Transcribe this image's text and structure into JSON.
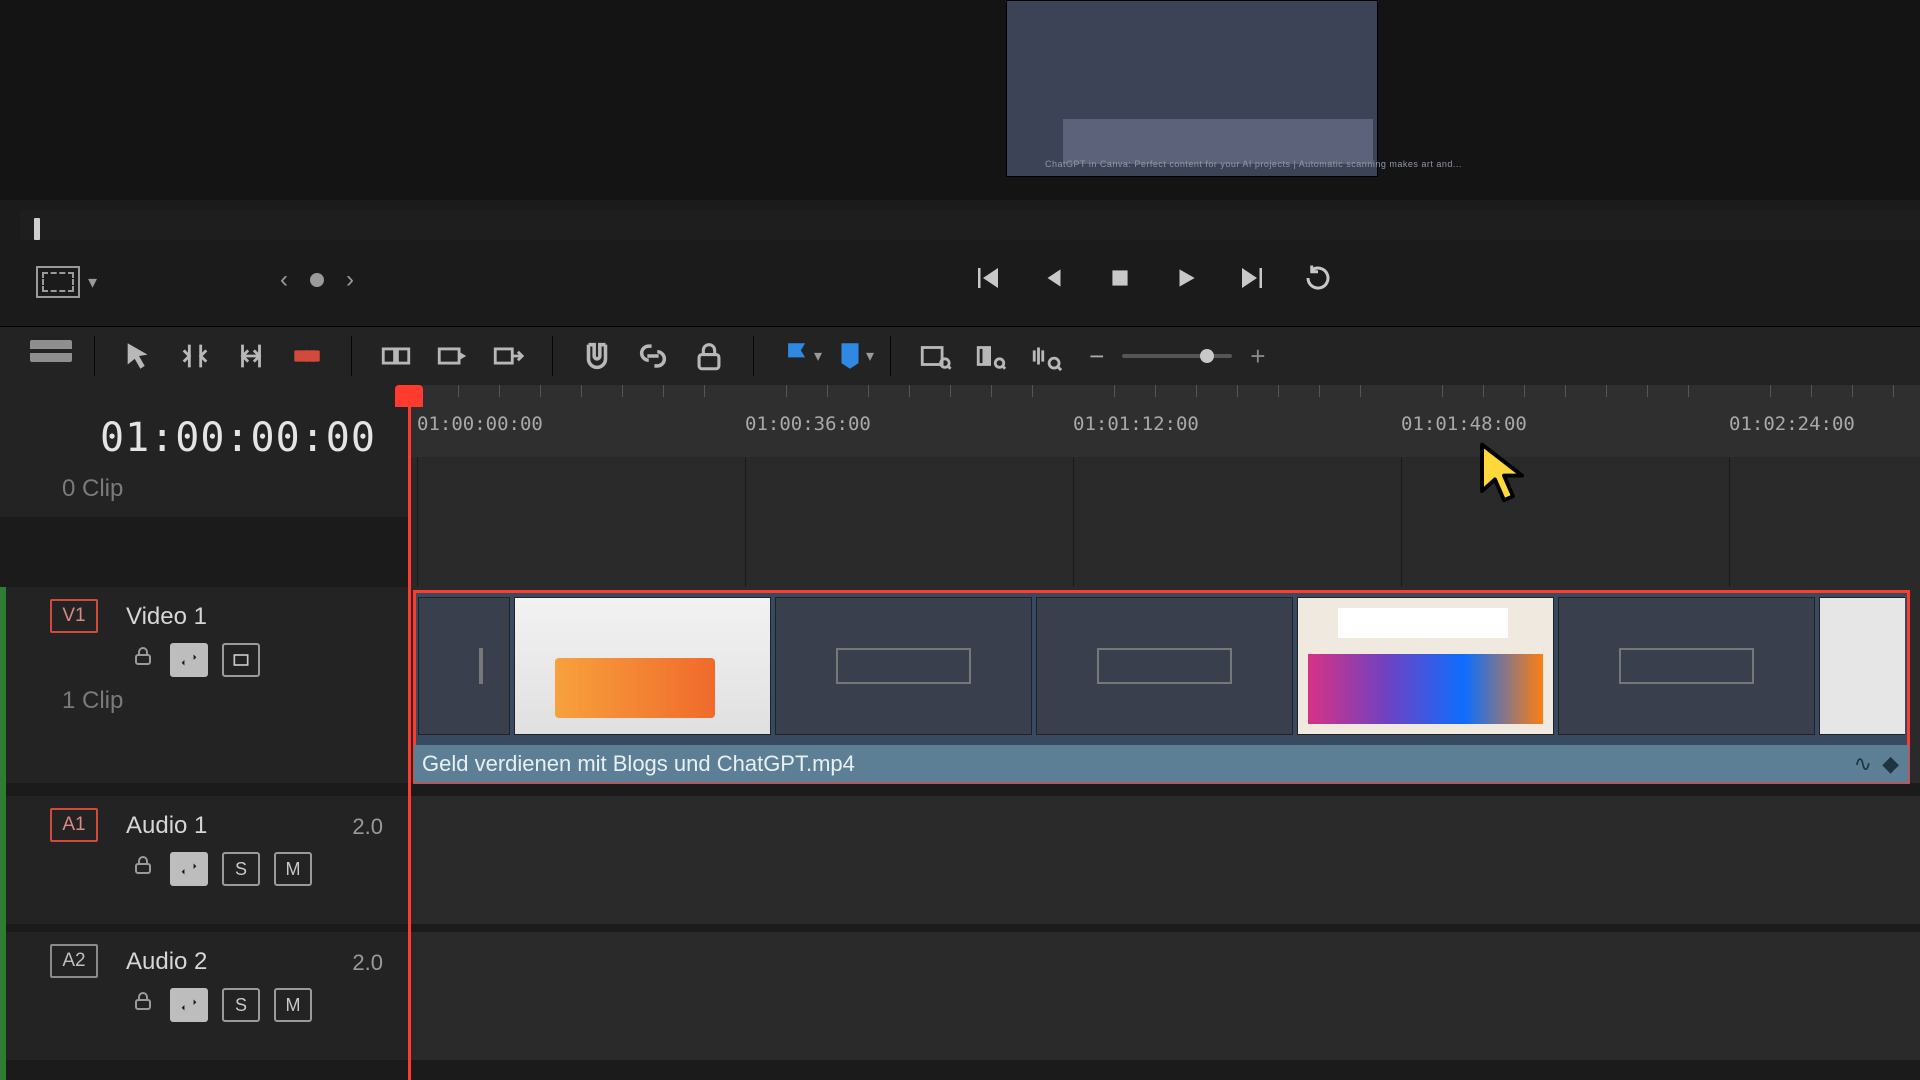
{
  "viewer_caption": "ChatGPT in Canva: Perfect content for your AI projects | Automatic scanning makes art and...",
  "transport": {
    "prev_chevron": "‹",
    "next_chevron": "›"
  },
  "toolbar": {
    "caret1": "▾",
    "caret2": "▾",
    "minus": "−",
    "plus": "+"
  },
  "timecode": "01:00:00:00",
  "ruler_labels": [
    "01:00:00:00",
    "01:00:36:00",
    "01:01:12:00",
    "01:01:48:00",
    "01:02:24:00"
  ],
  "clip_count_row": "0 Clip",
  "tracks": {
    "v1": {
      "badge": "V1",
      "name": "Video 1",
      "sub": "1 Clip"
    },
    "a1": {
      "badge": "A1",
      "name": "Audio 1",
      "ch": "2.0",
      "S": "S",
      "M": "M"
    },
    "a2": {
      "badge": "A2",
      "name": "Audio 2",
      "ch": "2.0",
      "S": "S",
      "M": "M"
    }
  },
  "clip_name": "Geld verdienen mit Blogs und ChatGPT.mp4",
  "zoom_knob_pct": 78
}
